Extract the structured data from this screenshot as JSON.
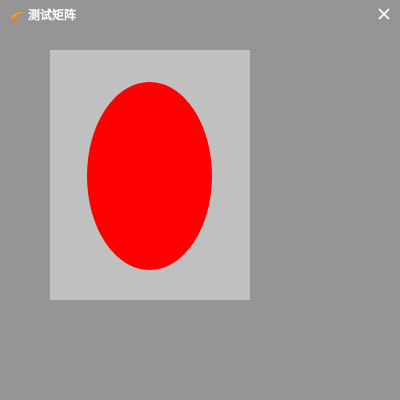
{
  "window": {
    "title": "测试矩阵",
    "app_icon": "orange-swoosh-icon",
    "close_icon": "close-icon",
    "background_color": "#959595"
  },
  "canvas": {
    "panel_color": "#c0c0c0",
    "shape": "ellipse",
    "shape_color": "#ff0000"
  }
}
